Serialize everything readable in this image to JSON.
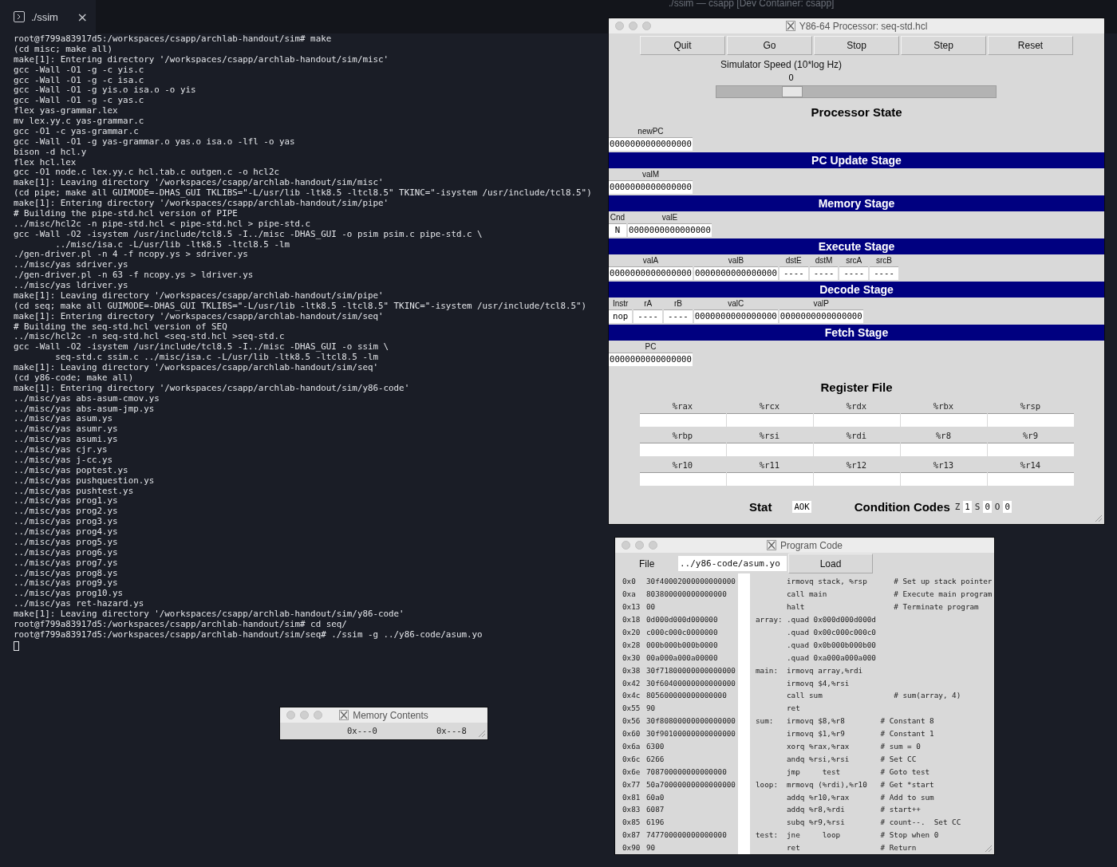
{
  "terminal": {
    "window_title": "./ssim — csapp [Dev Container: csapp]",
    "tab": {
      "label": "./ssim",
      "close": "×"
    },
    "lines": [
      "root@f799a83917d5:/workspaces/csapp/archlab-handout/sim# make",
      "(cd misc; make all)",
      "make[1]: Entering directory '/workspaces/csapp/archlab-handout/sim/misc'",
      "gcc -Wall -O1 -g -c yis.c",
      "gcc -Wall -O1 -g -c isa.c",
      "gcc -Wall -O1 -g yis.o isa.o -o yis",
      "gcc -Wall -O1 -g -c yas.c",
      "flex yas-grammar.lex",
      "mv lex.yy.c yas-grammar.c",
      "gcc -O1 -c yas-grammar.c",
      "gcc -Wall -O1 -g yas-grammar.o yas.o isa.o -lfl -o yas",
      "bison -d hcl.y",
      "flex hcl.lex",
      "gcc -O1 node.c lex.yy.c hcl.tab.c outgen.c -o hcl2c",
      "make[1]: Leaving directory '/workspaces/csapp/archlab-handout/sim/misc'",
      "(cd pipe; make all GUIMODE=-DHAS_GUI TKLIBS=\"-L/usr/lib -ltk8.5 -ltcl8.5\" TKINC=\"-isystem /usr/include/tcl8.5\")",
      "make[1]: Entering directory '/workspaces/csapp/archlab-handout/sim/pipe'",
      "# Building the pipe-std.hcl version of PIPE",
      "../misc/hcl2c -n pipe-std.hcl < pipe-std.hcl > pipe-std.c",
      "gcc -Wall -O2 -isystem /usr/include/tcl8.5 -I../misc -DHAS_GUI -o psim psim.c pipe-std.c \\",
      "        ../misc/isa.c -L/usr/lib -ltk8.5 -ltcl8.5 -lm",
      "./gen-driver.pl -n 4 -f ncopy.ys > sdriver.ys",
      "../misc/yas sdriver.ys",
      "./gen-driver.pl -n 63 -f ncopy.ys > ldriver.ys",
      "../misc/yas ldriver.ys",
      "make[1]: Leaving directory '/workspaces/csapp/archlab-handout/sim/pipe'",
      "(cd seq; make all GUIMODE=-DHAS_GUI TKLIBS=\"-L/usr/lib -ltk8.5 -ltcl8.5\" TKINC=\"-isystem /usr/include/tcl8.5\")",
      "make[1]: Entering directory '/workspaces/csapp/archlab-handout/sim/seq'",
      "# Building the seq-std.hcl version of SEQ",
      "../misc/hcl2c -n seq-std.hcl <seq-std.hcl >seq-std.c",
      "gcc -Wall -O2 -isystem /usr/include/tcl8.5 -I../misc -DHAS_GUI -o ssim \\",
      "        seq-std.c ssim.c ../misc/isa.c -L/usr/lib -ltk8.5 -ltcl8.5 -lm",
      "make[1]: Leaving directory '/workspaces/csapp/archlab-handout/sim/seq'",
      "(cd y86-code; make all)",
      "make[1]: Entering directory '/workspaces/csapp/archlab-handout/sim/y86-code'",
      "../misc/yas abs-asum-cmov.ys",
      "../misc/yas abs-asum-jmp.ys",
      "../misc/yas asum.ys",
      "../misc/yas asumr.ys",
      "../misc/yas asumi.ys",
      "../misc/yas cjr.ys",
      "../misc/yas j-cc.ys",
      "../misc/yas poptest.ys",
      "../misc/yas pushquestion.ys",
      "../misc/yas pushtest.ys",
      "../misc/yas prog1.ys",
      "../misc/yas prog2.ys",
      "../misc/yas prog3.ys",
      "../misc/yas prog4.ys",
      "../misc/yas prog5.ys",
      "../misc/yas prog6.ys",
      "../misc/yas prog7.ys",
      "../misc/yas prog8.ys",
      "../misc/yas prog9.ys",
      "../misc/yas prog10.ys",
      "../misc/yas ret-hazard.ys",
      "make[1]: Leaving directory '/workspaces/csapp/archlab-handout/sim/y86-code'",
      "root@f799a83917d5:/workspaces/csapp/archlab-handout/sim# cd seq/",
      "root@f799a83917d5:/workspaces/csapp/archlab-handout/sim/seq# ./ssim -g ../y86-code/asum.yo"
    ]
  },
  "processor": {
    "title": "Y86-64 Processor: seq-std.hcl",
    "buttons": [
      "Quit",
      "Go",
      "Stop",
      "Step",
      "Reset"
    ],
    "speed": {
      "label": "Simulator Speed (10*log Hz)",
      "value": "0",
      "level": 0.25
    },
    "heading": "Processor State",
    "sections": [
      {
        "kind": "fields",
        "fields": [
          {
            "label": "newPC",
            "value": "0000000000000000"
          }
        ]
      },
      {
        "kind": "banner",
        "text": "PC Update Stage"
      },
      {
        "kind": "fields",
        "fields": [
          {
            "label": "valM",
            "value": "0000000000000000"
          }
        ]
      },
      {
        "kind": "banner",
        "text": "Memory Stage"
      },
      {
        "kind": "fields",
        "fields": [
          {
            "label": "Cnd",
            "value": "N"
          },
          {
            "label": "valE",
            "value": "0000000000000000"
          }
        ]
      },
      {
        "kind": "banner",
        "text": "Execute Stage"
      },
      {
        "kind": "fields",
        "fields": [
          {
            "label": "valA",
            "value": "0000000000000000"
          },
          {
            "label": "valB",
            "value": "0000000000000000"
          },
          {
            "label": "dstE",
            "value": "----"
          },
          {
            "label": "dstM",
            "value": "----"
          },
          {
            "label": "srcA",
            "value": "----"
          },
          {
            "label": "srcB",
            "value": "----"
          }
        ]
      },
      {
        "kind": "banner",
        "text": "Decode Stage"
      },
      {
        "kind": "fields",
        "fields": [
          {
            "label": "Instr",
            "value": "nop"
          },
          {
            "label": "rA",
            "value": "----"
          },
          {
            "label": "rB",
            "value": "----"
          },
          {
            "label": "valC",
            "value": "0000000000000000"
          },
          {
            "label": "valP",
            "value": "0000000000000000"
          }
        ]
      },
      {
        "kind": "banner",
        "text": "Fetch Stage"
      },
      {
        "kind": "fields",
        "fields": [
          {
            "label": "PC",
            "value": "0000000000000000"
          }
        ]
      }
    ],
    "register_heading": "Register File",
    "registers": [
      {
        "name": "%rax"
      },
      {
        "name": "%rcx"
      },
      {
        "name": "%rdx"
      },
      {
        "name": "%rbx"
      },
      {
        "name": "%rsp"
      },
      {
        "name": "%rbp"
      },
      {
        "name": "%rsi"
      },
      {
        "name": "%rdi"
      },
      {
        "name": "%r8"
      },
      {
        "name": "%r9"
      },
      {
        "name": "%r10"
      },
      {
        "name": "%r11"
      },
      {
        "name": "%r12"
      },
      {
        "name": "%r13"
      },
      {
        "name": "%r14"
      }
    ],
    "stat": {
      "label": "Stat",
      "value": "AOK"
    },
    "condition_codes": {
      "label": "Condition Codes",
      "flags": [
        {
          "name": "Z",
          "value": "1"
        },
        {
          "name": "S",
          "value": "0"
        },
        {
          "name": "O",
          "value": "0"
        }
      ]
    }
  },
  "program": {
    "title": "Program Code",
    "file_label": "File",
    "file_value": "../y86-code/asum.yo",
    "load_button": "Load",
    "rows": [
      {
        "addr": "0x0",
        "bytes": "30f40002000000000000",
        "code": "irmovq stack, %rsp      # Set up stack pointer"
      },
      {
        "addr": "0xa",
        "bytes": "803800000000000000",
        "code": "call main               # Execute main program"
      },
      {
        "addr": "0x13",
        "bytes": "00",
        "code": "halt                    # Terminate program"
      },
      {
        "addr": "0x18",
        "bytes": "0d000d000d000000",
        "label": "array:",
        "code": ".quad 0x000d000d000d"
      },
      {
        "addr": "0x20",
        "bytes": "c000c000c0000000",
        "code": ".quad 0x00c000c000c0"
      },
      {
        "addr": "0x28",
        "bytes": "000b000b000b0000",
        "code": ".quad 0x0b000b000b00"
      },
      {
        "addr": "0x30",
        "bytes": "00a000a000a00000",
        "code": ".quad 0xa000a000a000"
      },
      {
        "addr": "0x38",
        "bytes": "30f71800000000000000",
        "label": "main:",
        "code": "irmovq array,%rdi"
      },
      {
        "addr": "0x42",
        "bytes": "30f60400000000000000",
        "code": "irmovq $4,%rsi"
      },
      {
        "addr": "0x4c",
        "bytes": "805600000000000000",
        "code": "call sum                # sum(array, 4)"
      },
      {
        "addr": "0x55",
        "bytes": "90",
        "code": "ret"
      },
      {
        "addr": "0x56",
        "bytes": "30f80800000000000000",
        "label": "sum:",
        "code": "irmovq $8,%r8        # Constant 8"
      },
      {
        "addr": "0x60",
        "bytes": "30f90100000000000000",
        "code": "irmovq $1,%r9        # Constant 1"
      },
      {
        "addr": "0x6a",
        "bytes": "6300",
        "code": "xorq %rax,%rax       # sum = 0"
      },
      {
        "addr": "0x6c",
        "bytes": "6266",
        "code": "andq %rsi,%rsi       # Set CC"
      },
      {
        "addr": "0x6e",
        "bytes": "708700000000000000",
        "code": "jmp     test         # Goto test"
      },
      {
        "addr": "0x77",
        "bytes": "50a70000000000000000",
        "label": "loop:",
        "code": "mrmovq (%rdi),%r10   # Get *start"
      },
      {
        "addr": "0x81",
        "bytes": "60a0",
        "code": "addq %r10,%rax       # Add to sum"
      },
      {
        "addr": "0x83",
        "bytes": "6087",
        "code": "addq %r8,%rdi        # start++"
      },
      {
        "addr": "0x85",
        "bytes": "6196",
        "code": "subq %r9,%rsi        # count--.  Set CC"
      },
      {
        "addr": "0x87",
        "bytes": "747700000000000000",
        "label": "test:",
        "code": "jne     loop         # Stop when 0"
      },
      {
        "addr": "0x90",
        "bytes": "90",
        "code": "ret                  # Return"
      }
    ]
  },
  "memory": {
    "title": "Memory Contents",
    "columns": [
      "0x---0",
      "0x---8"
    ]
  }
}
